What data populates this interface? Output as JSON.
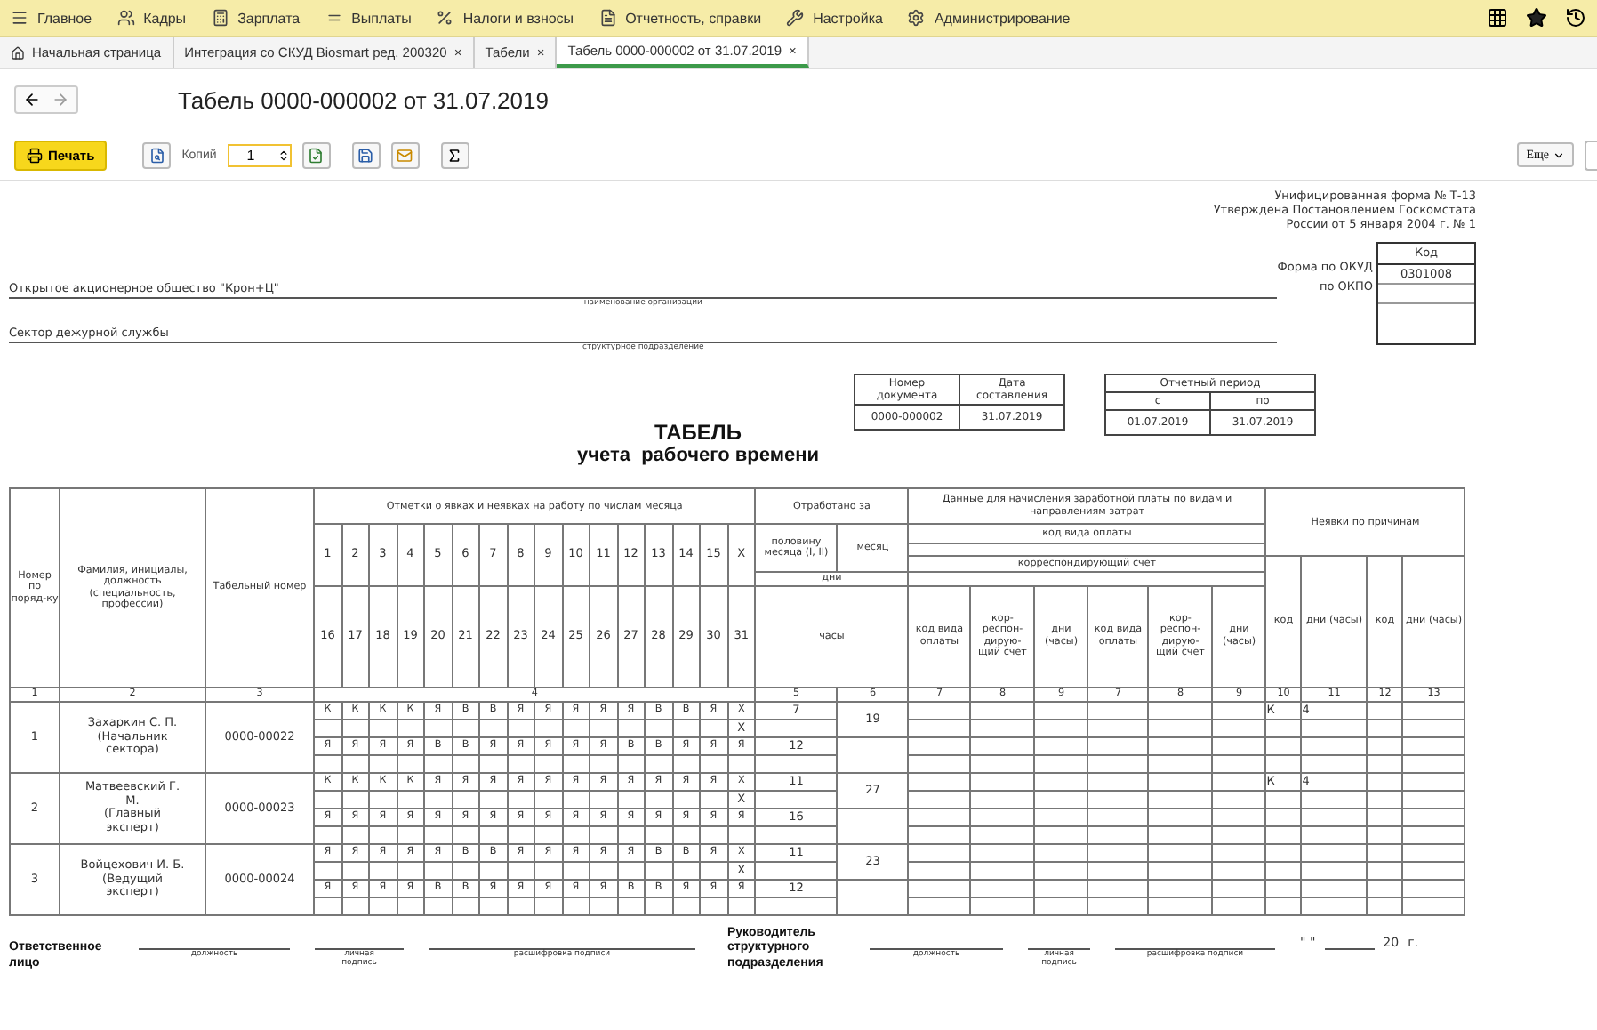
{
  "menu": [
    {
      "label": "Главное"
    },
    {
      "label": "Кадры"
    },
    {
      "label": "Зарплата"
    },
    {
      "label": "Выплаты"
    },
    {
      "label": "Налоги и взносы"
    },
    {
      "label": "Отчетность, справки"
    },
    {
      "label": "Настройка"
    },
    {
      "label": "Администрирование"
    }
  ],
  "tabs": [
    {
      "label": "Начальная страница",
      "selected": false
    },
    {
      "label": "Интеграция со СКУД Biosmart ред. 200320",
      "close": "×",
      "selected": false
    },
    {
      "label": "Табели",
      "close": "×",
      "selected": false
    },
    {
      "label": "Табель 0000-000002 от 31.07.2019",
      "close": "×",
      "selected": true
    }
  ],
  "doc_title": "Табель 0000-000002 от 31.07.2019",
  "toolbar": {
    "print": "Печать",
    "copies_label": "Копий",
    "copies": "1",
    "more": "Еще"
  },
  "form": {
    "unified": [
      "Унифицированная форма № Т-13",
      "Утверждена Постановлением Госкомстата",
      "России от 5 января 2004 г. № 1"
    ],
    "code_header": "Код",
    "okud_label": "Форма по ОКУД",
    "okud": "0301008",
    "okpo_label": "по ОКПО",
    "organization": "Открытое акционерное общество \"Крон+Ц\"",
    "organization_caption": "наименование организации",
    "department": "Сектор дежурной службы",
    "department_caption": "структурное подразделение",
    "doc_number_label": "Номер документа",
    "doc_date_label": "Дата составления",
    "doc_number": "0000-000002",
    "doc_date": "31.07.2019",
    "period_label": "Отчетный период",
    "period_from_label": "с",
    "period_to_label": "по",
    "period_from": "01.07.2019",
    "period_to": "31.07.2019",
    "title": "ТАБЕЛЬ",
    "subtitle": "учета  рабочего времени"
  },
  "table": {
    "h_number": "Номер по поряд-ку",
    "h_name": "Фамилия, инициалы, должность (специальность, профессии)",
    "h_tab": "Табельный номер",
    "h_marks": "Отметки о явках и неявках на работу по числам месяца",
    "days_first": [
      "1",
      "2",
      "3",
      "4",
      "5",
      "6",
      "7",
      "8",
      "9",
      "10",
      "11",
      "12",
      "13",
      "14",
      "15",
      "X"
    ],
    "days_second": [
      "16",
      "17",
      "18",
      "19",
      "20",
      "21",
      "22",
      "23",
      "24",
      "25",
      "26",
      "27",
      "28",
      "29",
      "30",
      "31"
    ],
    "h_worked": "Отработано за",
    "h_half": "половину месяца (I, II)",
    "h_month": "месяц",
    "h_days": "дни",
    "h_hours": "часы",
    "h_pay": "Данные для начисления заработной платы по видам и направлениям затрат",
    "h_pay_code": "код вида оплаты",
    "h_account": "корреспондирующий счет",
    "pay_cols": [
      "код вида оплаты",
      "кор-респон-дирую-щий счет",
      "дни (часы)",
      "код вида оплаты",
      "кор-респон-дирую-щий счет",
      "дни (часы)"
    ],
    "h_absence": "Неявки по причинам",
    "absence_cols": [
      "код",
      "дни (часы)",
      "код",
      "дни (часы)"
    ],
    "col_numbers": [
      "1",
      "2",
      "3",
      "4",
      "5",
      "6",
      "7",
      "8",
      "9",
      "7",
      "8",
      "9",
      "10",
      "11",
      "12",
      "13"
    ],
    "employees": [
      {
        "number": "1",
        "name": "Захаркин С. П.",
        "position": "(Начальник сектора)",
        "tab": "0000-00022",
        "x_mark": "X",
        "days_first": "7",
        "days_second": "12",
        "days_month": "19",
        "absence_code": "К",
        "absence_days": "4",
        "marks_first": [
          "К",
          "К",
          "К",
          "К",
          "Я",
          "В",
          "В",
          "Я",
          "Я",
          "Я",
          "Я",
          "Я",
          "В",
          "В",
          "Я",
          "X"
        ],
        "marks_second": [
          "Я",
          "Я",
          "Я",
          "Я",
          "В",
          "В",
          "Я",
          "Я",
          "Я",
          "Я",
          "Я",
          "В",
          "В",
          "Я",
          "Я",
          "Я"
        ]
      },
      {
        "number": "2",
        "name": "Матвеевский Г. М.",
        "position": "(Главный эксперт)",
        "tab": "0000-00023",
        "x_mark": "X",
        "days_first": "11",
        "days_second": "16",
        "days_month": "27",
        "absence_code": "К",
        "absence_days": "4",
        "marks_first": [
          "К",
          "К",
          "К",
          "К",
          "Я",
          "Я",
          "Я",
          "Я",
          "Я",
          "Я",
          "Я",
          "Я",
          "Я",
          "Я",
          "Я",
          "X"
        ],
        "marks_second": [
          "Я",
          "Я",
          "Я",
          "Я",
          "Я",
          "Я",
          "Я",
          "Я",
          "Я",
          "Я",
          "Я",
          "Я",
          "Я",
          "Я",
          "Я",
          "Я"
        ]
      },
      {
        "number": "3",
        "name": "Войцехович И. Б.",
        "position": "(Ведущий эксперт)",
        "tab": "0000-00024",
        "x_mark": "X",
        "days_first": "11",
        "days_second": "12",
        "days_month": "23",
        "marks_first": [
          "Я",
          "Я",
          "Я",
          "Я",
          "Я",
          "В",
          "В",
          "Я",
          "Я",
          "Я",
          "Я",
          "Я",
          "В",
          "В",
          "Я",
          "X"
        ],
        "marks_second": [
          "Я",
          "Я",
          "Я",
          "Я",
          "В",
          "В",
          "Я",
          "Я",
          "Я",
          "Я",
          "Я",
          "В",
          "В",
          "Я",
          "Я",
          "Я"
        ]
      }
    ]
  },
  "footer": {
    "responsible": "Ответственное лицо",
    "head": "Руководитель структурного подразделения",
    "responsible_captions": [
      "должность",
      "личная подпись",
      "расшифровка подписи"
    ],
    "head_captions": [
      "должность",
      "личная подпись",
      "расшифровка подписи"
    ],
    "date_quotes": "\" \"",
    "year": "20",
    "year_suffix": "г."
  }
}
